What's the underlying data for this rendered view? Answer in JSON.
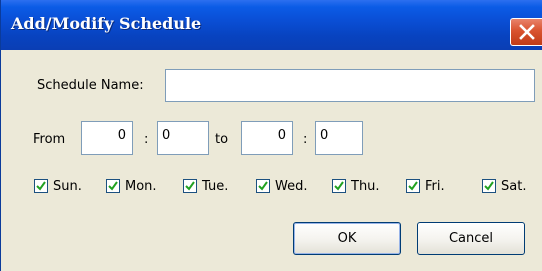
{
  "window": {
    "title": "Add/Modify Schedule"
  },
  "icons": {
    "close": "close-x-icon",
    "check": "checkmark-icon"
  },
  "colors": {
    "titlebar": "#0a4fd6",
    "close_button": "#d9532f",
    "dialog_bg": "#ece9d8"
  },
  "schedule_name": {
    "label": "Schedule Name:",
    "value": ""
  },
  "time": {
    "from_label": "From",
    "from_hour": "0",
    "sep1": ":",
    "from_minute": "0",
    "to_label": "to",
    "to_hour": "0",
    "sep2": ":",
    "to_minute": "0"
  },
  "days": [
    {
      "label": "Sun.",
      "checked": true
    },
    {
      "label": "Mon.",
      "checked": true
    },
    {
      "label": "Tue.",
      "checked": true
    },
    {
      "label": "Wed.",
      "checked": true
    },
    {
      "label": "Thu.",
      "checked": true
    },
    {
      "label": "Fri.",
      "checked": true
    },
    {
      "label": "Sat.",
      "checked": true
    }
  ],
  "buttons": {
    "ok": "OK",
    "cancel": "Cancel"
  }
}
